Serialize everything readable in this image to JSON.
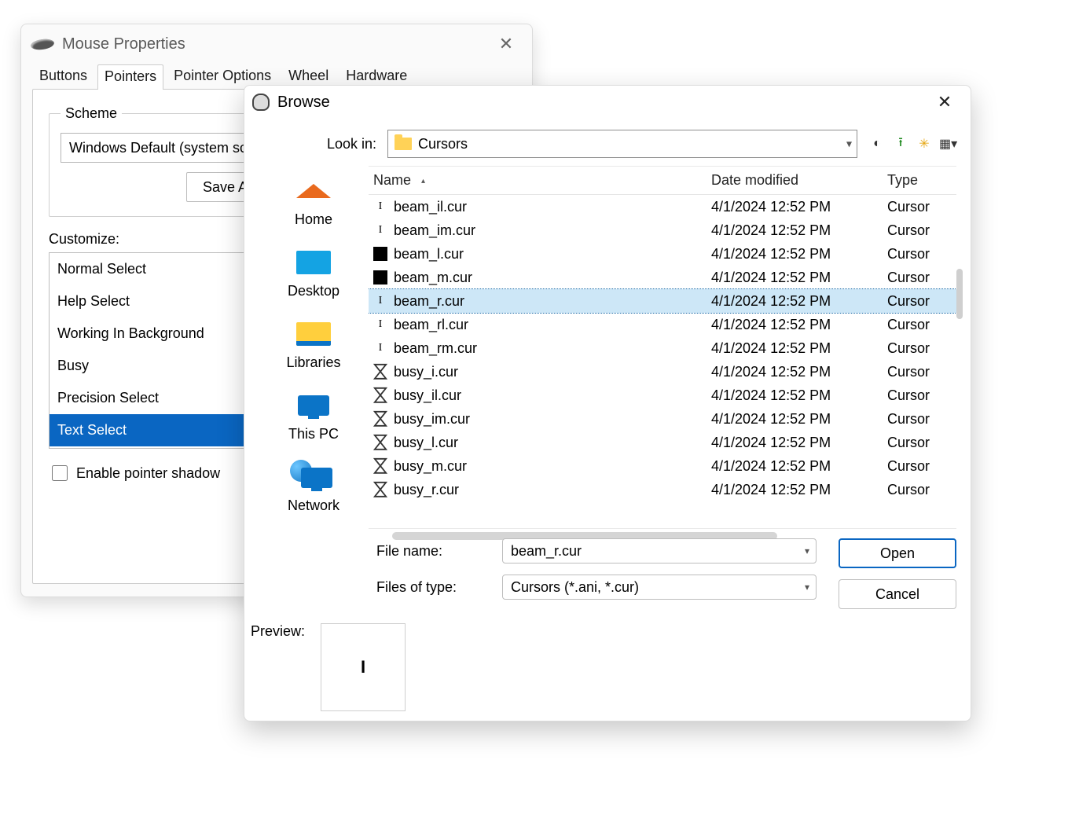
{
  "mouse_properties": {
    "title": "Mouse Properties",
    "tabs": [
      "Buttons",
      "Pointers",
      "Pointer Options",
      "Wheel",
      "Hardware"
    ],
    "active_tab_index": 1,
    "scheme": {
      "legend": "Scheme",
      "value": "Windows Default (system scheme)",
      "save_as_label": "Save As..."
    },
    "customize_label": "Customize:",
    "customize_items": [
      "Normal Select",
      "Help Select",
      "Working In Background",
      "Busy",
      "Precision Select",
      "Text Select"
    ],
    "customize_selected_index": 5,
    "enable_shadow_label": "Enable pointer shadow",
    "enable_shadow_checked": false
  },
  "browse": {
    "title": "Browse",
    "lookin_label": "Look in:",
    "lookin_value": "Cursors",
    "nav_icons": [
      "back-icon",
      "up-icon",
      "new-folder-icon",
      "view-icon"
    ],
    "places": [
      "Home",
      "Desktop",
      "Libraries",
      "This PC",
      "Network"
    ],
    "columns": {
      "name": "Name",
      "date": "Date modified",
      "type": "Type"
    },
    "rows": [
      {
        "icon": "ibeam",
        "name": "beam_il.cur",
        "date": "4/1/2024 12:52 PM",
        "type": "Cursor"
      },
      {
        "icon": "ibeam",
        "name": "beam_im.cur",
        "date": "4/1/2024 12:52 PM",
        "type": "Cursor"
      },
      {
        "icon": "black",
        "name": "beam_l.cur",
        "date": "4/1/2024 12:52 PM",
        "type": "Cursor"
      },
      {
        "icon": "black",
        "name": "beam_m.cur",
        "date": "4/1/2024 12:52 PM",
        "type": "Cursor"
      },
      {
        "icon": "ibeam",
        "name": "beam_r.cur",
        "date": "4/1/2024 12:52 PM",
        "type": "Cursor"
      },
      {
        "icon": "ibeam",
        "name": "beam_rl.cur",
        "date": "4/1/2024 12:52 PM",
        "type": "Cursor"
      },
      {
        "icon": "ibeam",
        "name": "beam_rm.cur",
        "date": "4/1/2024 12:52 PM",
        "type": "Cursor"
      },
      {
        "icon": "hour",
        "name": "busy_i.cur",
        "date": "4/1/2024 12:52 PM",
        "type": "Cursor"
      },
      {
        "icon": "hour",
        "name": "busy_il.cur",
        "date": "4/1/2024 12:52 PM",
        "type": "Cursor"
      },
      {
        "icon": "hour",
        "name": "busy_im.cur",
        "date": "4/1/2024 12:52 PM",
        "type": "Cursor"
      },
      {
        "icon": "hour",
        "name": "busy_l.cur",
        "date": "4/1/2024 12:52 PM",
        "type": "Cursor"
      },
      {
        "icon": "hour",
        "name": "busy_m.cur",
        "date": "4/1/2024 12:52 PM",
        "type": "Cursor"
      },
      {
        "icon": "hour",
        "name": "busy_r.cur",
        "date": "4/1/2024 12:52 PM",
        "type": "Cursor"
      }
    ],
    "selected_row_index": 4,
    "file_name_label": "File name:",
    "file_name_value": "beam_r.cur",
    "files_of_type_label": "Files of type:",
    "files_of_type_value": "Cursors (*.ani, *.cur)",
    "open_label": "Open",
    "cancel_label": "Cancel",
    "preview_label": "Preview:",
    "preview_glyph": "I"
  }
}
